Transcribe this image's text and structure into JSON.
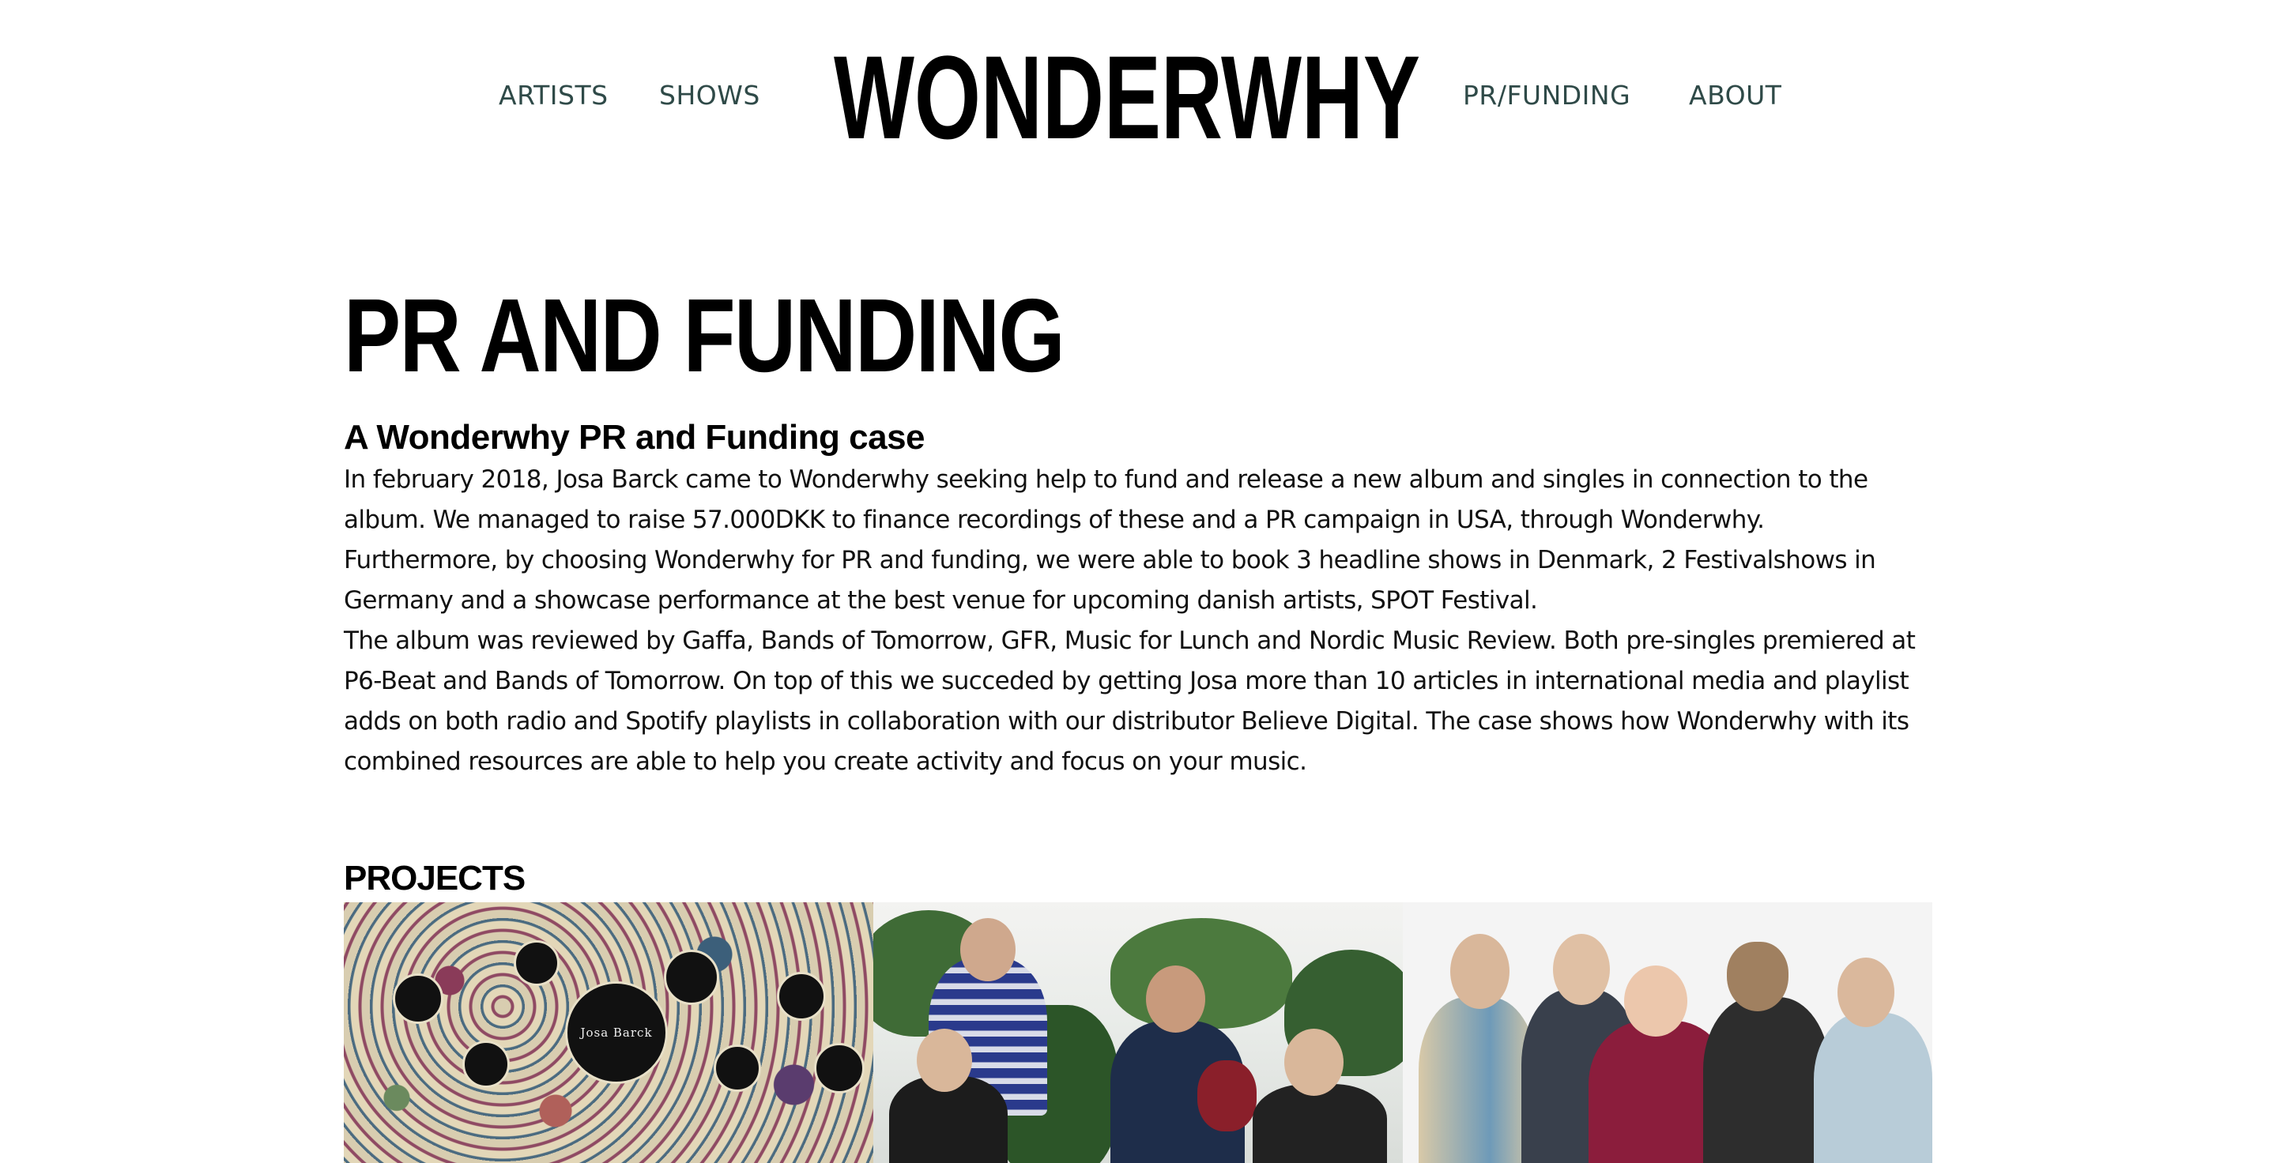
{
  "nav": {
    "left": [
      "ARTISTS",
      "SHOWS"
    ],
    "right": [
      "PR/FUNDING",
      "ABOUT"
    ]
  },
  "logo": "WONDERWHY",
  "page": {
    "title": "PR AND FUNDING",
    "case_title": "A Wonderwhy PR and Funding case",
    "paragraphs": [
      "In february 2018, Josa Barck came to Wonderwhy seeking help to fund and release a new album and singles in connection to the album. We managed to raise 57.000DKK to finance recordings of these and a PR campaign in USA, through Wonderwhy.",
      "Furthermore, by choosing Wonderwhy for PR and funding, we were able to book 3 headline shows in Denmark, 2 Festivalshows in Germany and a showcase performance at the best venue for upcoming danish artists, SPOT Festival.",
      "The album was reviewed by Gaffa, Bands of Tomorrow, GFR, Music for Lunch and Nordic Music Review. Both pre-singles premiered at P6-Beat and Bands of Tomorrow. On top of this we succeded by getting Josa more than 10 articles in international media and playlist adds on both radio and Spotify playlists in collaboration with our distributor Believe Digital. The case shows how Wonderwhy with its combined resources are able to help you create activity and focus on your music."
    ]
  },
  "projects": {
    "title": "PROJECTS",
    "poster_text": "Josa Barck"
  }
}
